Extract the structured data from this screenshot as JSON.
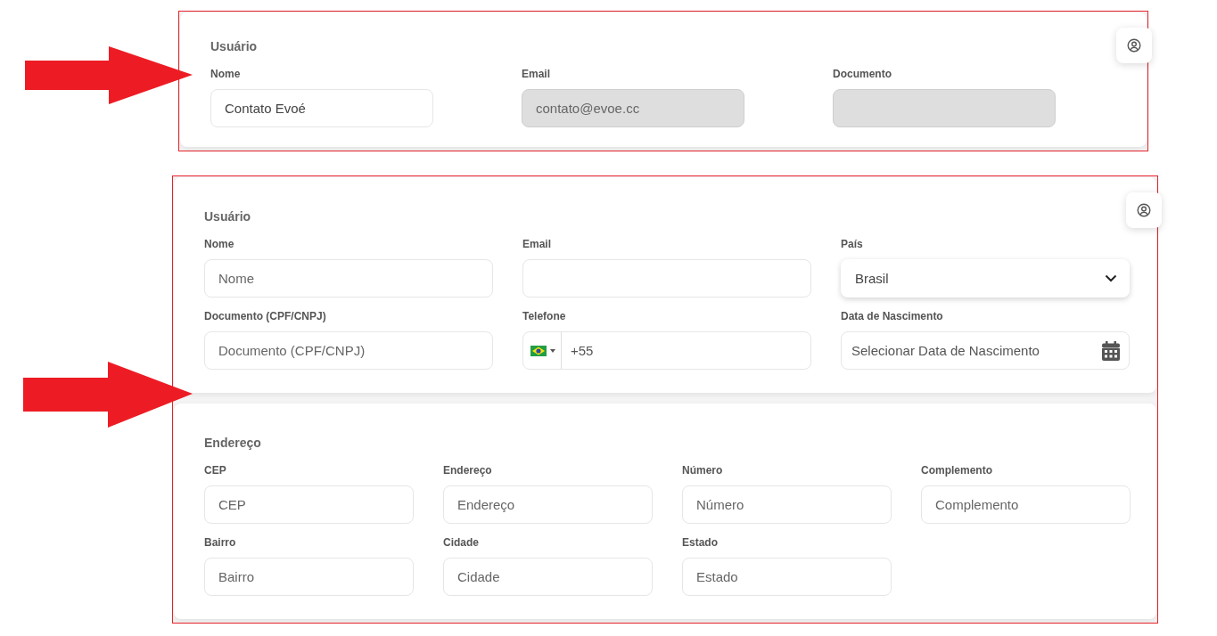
{
  "frames": [
    {
      "cards": [
        {
          "title": "Usuário",
          "kind": "user",
          "fields": [
            {
              "kind": "text",
              "label": "Nome",
              "value": "Contato Evoé",
              "disabled": false
            },
            {
              "kind": "text",
              "label": "Email",
              "value": "contato@evoe.cc",
              "disabled": true
            },
            {
              "kind": "text",
              "label": "Documento",
              "disabled": true
            }
          ],
          "profile_button": true
        }
      ]
    },
    {
      "cards": [
        {
          "title": "Usuário",
          "kind": "user",
          "fields": [
            {
              "kind": "text",
              "label": "Nome",
              "placeholder": "Nome",
              "disabled": false
            },
            {
              "kind": "text",
              "label": "Email",
              "disabled": false
            },
            {
              "kind": "select",
              "label": "País",
              "value": "Brasil",
              "disabled": false
            },
            {
              "kind": "text",
              "label": "Documento (CPF/CNPJ)",
              "placeholder": "Documento (CPF/CNPJ)",
              "disabled": false
            },
            {
              "kind": "phone",
              "label": "Telefone",
              "value": "+55",
              "disabled": false
            },
            {
              "kind": "date",
              "label": "Data de Nascimento",
              "placeholder": "Selecionar Data de Nascimento",
              "disabled": false
            }
          ],
          "profile_button": true
        },
        {
          "title": "Endereço",
          "kind": "address",
          "fields": [
            {
              "kind": "text",
              "label": "CEP",
              "placeholder": "CEP",
              "disabled": false
            },
            {
              "kind": "text",
              "label": "Endereço",
              "placeholder": "Endereço",
              "disabled": false
            },
            {
              "kind": "text",
              "label": "Número",
              "placeholder": "Número",
              "disabled": false
            },
            {
              "kind": "text",
              "label": "Complemento",
              "placeholder": "Complemento",
              "disabled": false
            },
            {
              "kind": "text",
              "label": "Bairro",
              "placeholder": "Bairro",
              "disabled": false
            },
            {
              "kind": "text",
              "label": "Cidade",
              "placeholder": "Cidade",
              "disabled": false
            },
            {
              "kind": "text",
              "label": "Estado",
              "placeholder": "Estado",
              "disabled": false
            }
          ],
          "profile_button": false
        }
      ]
    }
  ]
}
